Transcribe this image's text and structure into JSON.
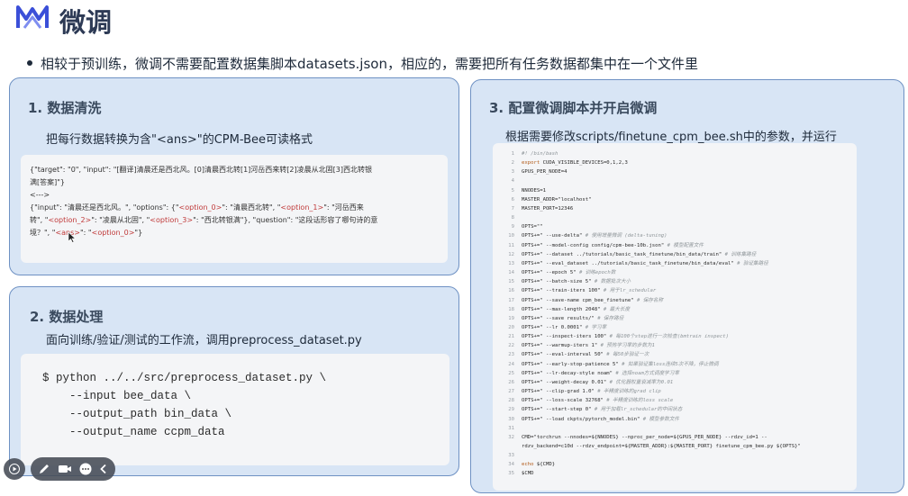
{
  "header": {
    "title": "微调",
    "logo_icon": "mountain-logo-icon",
    "accent_color": "#3b4fd8"
  },
  "bullet": {
    "text": "相较于预训练，微调不需要配置数据集脚本datasets.json，相应的，需要把所有任务数据都集中在一个文件里"
  },
  "section1": {
    "title": "1. 数据清洗",
    "description": "把每行数据转换为含\"<ans>\"的CPM-Bee可读格式",
    "code_lines": [
      "{\"target\": \"0\", \"input\": \"[翻译]清晨还是西北风。[0]清晨西北转[1]河岳西来转[2]凌晨从北固[3]西北转银",
      "满[答案]\"}",
      "<--->",
      "{\"input\": \"清晨还是西北风。\", \"options\": {\"<option_0>\": \"清晨西北转\", \"<option_1>\": \"河岳西来",
      "转\", \"<option_2>\": \"凌晨从北固\", \"<option_3>\": \"西北转银满\"}, \"question\": \"这段话形容了哪句诗的意",
      "境？\", \"<ans>\": \"<option_0>\"}"
    ]
  },
  "section2": {
    "title": "2. 数据处理",
    "description": "面向训练/验证/测试的工作流，调用preprocess_dataset.py",
    "code_lines": [
      "$ python ../../src/preprocess_dataset.py \\",
      "    --input bee_data \\",
      "    --output_path bin_data \\",
      "    --output_name ccpm_data"
    ]
  },
  "section3": {
    "title": "3. 配置微调脚本并开启微调",
    "description": "根据需要修改scripts/finetune_cpm_bee.sh中的参数，并运行",
    "script_lines": [
      {
        "n": "1",
        "code": "#! /bin/bash",
        "comment": ""
      },
      {
        "n": "2",
        "code": "export CUDA_VISIBLE_DEVICES=0,1,2,3",
        "comment": ""
      },
      {
        "n": "3",
        "code": "GPUS_PER_NODE=4",
        "comment": ""
      },
      {
        "n": "4",
        "code": "",
        "comment": ""
      },
      {
        "n": "5",
        "code": "NNODES=1",
        "comment": ""
      },
      {
        "n": "6",
        "code": "MASTER_ADDR=\"localhost\"",
        "comment": ""
      },
      {
        "n": "7",
        "code": "MASTER_PORT=12346",
        "comment": ""
      },
      {
        "n": "8",
        "code": "",
        "comment": ""
      },
      {
        "n": "9",
        "code": "OPTS=\"\"",
        "comment": ""
      },
      {
        "n": "10",
        "code": "OPTS+=\" --use-delta\"",
        "comment": "# 使用增量微调 (delta-tuning)"
      },
      {
        "n": "11",
        "code": "OPTS+=\" --model-config config/cpm-bee-10b.json\"",
        "comment": "# 模型配置文件"
      },
      {
        "n": "12",
        "code": "OPTS+=\" --dataset ../tutorials/basic_task_finetune/bin_data/train\"",
        "comment": "# 训练集路径"
      },
      {
        "n": "13",
        "code": "OPTS+=\" --eval_dataset ../tutorials/basic_task_finetune/bin_data/eval\"",
        "comment": "# 验证集路径"
      },
      {
        "n": "14",
        "code": "OPTS+=\" --epoch 5\"",
        "comment": "# 训练epoch数"
      },
      {
        "n": "15",
        "code": "OPTS+=\" --batch-size 5\"",
        "comment": "# 数据批次大小"
      },
      {
        "n": "16",
        "code": "OPTS+=\" --train-iters 100\"",
        "comment": "# 用于lr_schedular"
      },
      {
        "n": "17",
        "code": "OPTS+=\" --save-name cpm_bee_finetune\"",
        "comment": "# 保存名称"
      },
      {
        "n": "18",
        "code": "OPTS+=\" --max-length 2048\"",
        "comment": "# 最大长度"
      },
      {
        "n": "19",
        "code": "OPTS+=\" --save results/\"",
        "comment": "# 保存路径"
      },
      {
        "n": "20",
        "code": "OPTS+=\" --lr 0.0001\"",
        "comment": "# 学习率"
      },
      {
        "n": "21",
        "code": "OPTS+=\" --inspect-iters 100\"",
        "comment": "# 每100个step进行一次检查(bmtrain inspect)"
      },
      {
        "n": "22",
        "code": "OPTS+=\" --warmup-iters 1\"",
        "comment": "# 预热学习率的步数为1"
      },
      {
        "n": "23",
        "code": "OPTS+=\" --eval-interval 50\"",
        "comment": "# 每50步验证一次"
      },
      {
        "n": "24",
        "code": "OPTS+=\" --early-stop-patience 5\"",
        "comment": "# 如果验证集loss连续5次不降，停止微调"
      },
      {
        "n": "25",
        "code": "OPTS+=\" --lr-decay-style noam\"",
        "comment": "# 选择noam方式调度学习率"
      },
      {
        "n": "26",
        "code": "OPTS+=\" --weight-decay 0.01\"",
        "comment": "# 优化器权重衰减率为0.01"
      },
      {
        "n": "27",
        "code": "OPTS+=\" --clip-grad 1.0\"",
        "comment": "# 半精度训练的grad clip"
      },
      {
        "n": "28",
        "code": "OPTS+=\" --loss-scale 32768\"",
        "comment": "# 半精度训练的loss scale"
      },
      {
        "n": "29",
        "code": "OPTS+=\" --start-step 0\"",
        "comment": "# 用于加载lr_schedular的中间状态"
      },
      {
        "n": "30",
        "code": "OPTS+=\" --load ckpts/pytorch_model.bin\"",
        "comment": "# 模型参数文件"
      },
      {
        "n": "31",
        "code": "",
        "comment": ""
      },
      {
        "n": "32",
        "code": "CMD=\"torchrun --nnodes=${NNODES} --nproc_per_node=${GPUS_PER_NODE} --rdzv_id=1 --",
        "comment": ""
      },
      {
        "n": "",
        "code": "rdzv_backend=c10d --rdzv_endpoint=${MASTER_ADDR}:${MASTER_PORT} finetune_cpm_bee.py ${OPTS}\"",
        "comment": ""
      },
      {
        "n": "33",
        "code": "",
        "comment": ""
      },
      {
        "n": "34",
        "code": "echo ${CMD}",
        "comment": ""
      },
      {
        "n": "35",
        "code": "$CMD",
        "comment": ""
      }
    ]
  },
  "toolbar": {
    "icons": [
      "play-icon",
      "pen-icon",
      "camera-icon",
      "more-icon",
      "collapse-icon"
    ]
  }
}
